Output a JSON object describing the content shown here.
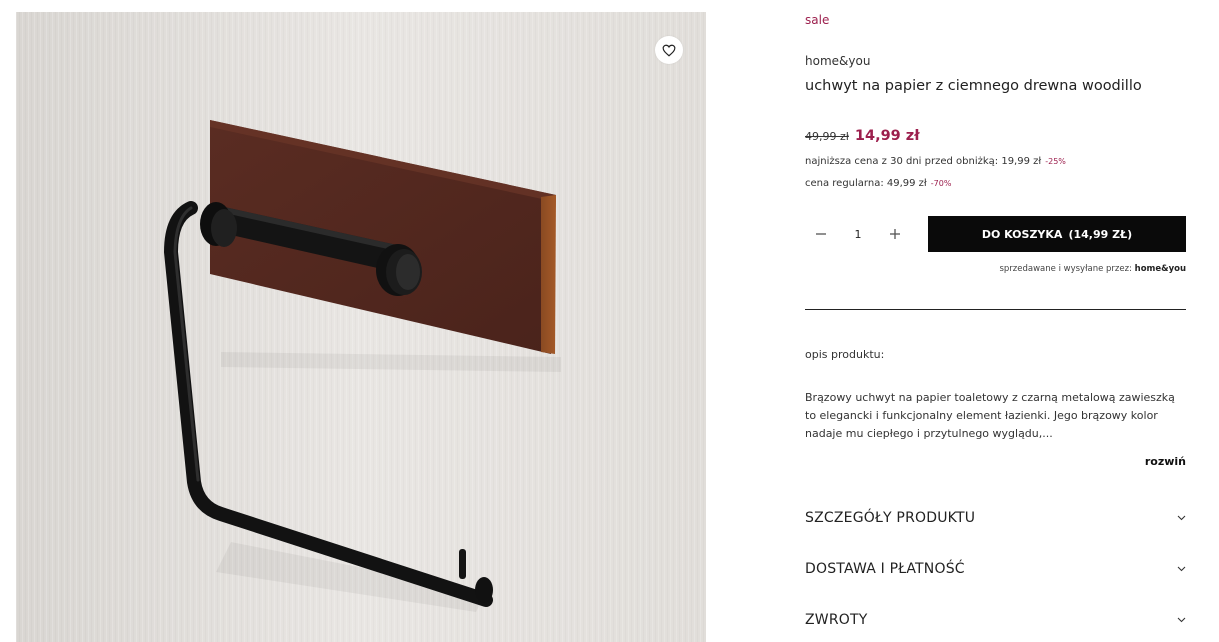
{
  "gallery": {
    "image_alt": "uchwyt na papier z ciemnego drewna woodillo",
    "favorite_icon": "heart-icon"
  },
  "product": {
    "sale_label": "sale",
    "brand": "home&you",
    "title": "uchwyt na papier z ciemnego drewna woodillo",
    "old_price": "49,99 zł",
    "new_price": "14,99 zł",
    "lowest_price_label": "najniższa cena z 30 dni przed obniżką: 19,99 zł",
    "lowest_price_discount": "-25%",
    "regular_price_label": "cena regularna: 49,99 zł",
    "regular_price_discount": "-70%"
  },
  "quantity": {
    "minus_icon": "minus-icon",
    "value": "1",
    "plus_icon": "plus-icon"
  },
  "cart": {
    "button_label": "DO KOSZYKA",
    "button_price": "(14,99 ZŁ)"
  },
  "seller": {
    "label": "sprzedawane i wysyłane przez:",
    "name": "home&you"
  },
  "description": {
    "label": "opis produktu:",
    "text": "Brązowy uchwyt na papier toaletowy z czarną metalową zawieszką to elegancki i funkcjonalny element łazienki. Jego brązowy kolor nadaje mu ciepłego i przytulnego wyglądu,...",
    "expand_label": "rozwiń"
  },
  "accordions": [
    {
      "label": "SZCZEGÓŁY PRODUKTU"
    },
    {
      "label": "DOSTAWA I PŁATNOŚĆ"
    },
    {
      "label": "ZWROTY"
    }
  ],
  "colors": {
    "accent": "#9c1f4d",
    "button_bg": "#0a0a0a",
    "text": "#222222"
  }
}
